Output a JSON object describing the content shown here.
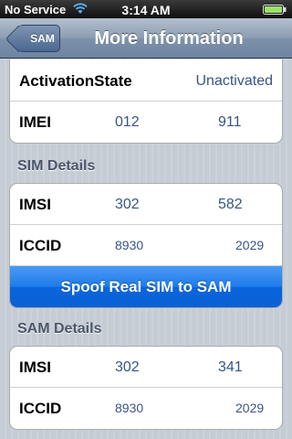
{
  "status_bar": {
    "carrier": "No Service",
    "time": "3:14 AM"
  },
  "nav": {
    "back_label": "SAM",
    "title": "More Information"
  },
  "info": {
    "activation_label": "ActivationState",
    "activation_value": "Unactivated",
    "imei_label": "IMEI",
    "imei_part1": "012",
    "imei_part2": "911"
  },
  "sim_details": {
    "header": "SIM Details",
    "imsi_label": "IMSI",
    "imsi_part1": "302",
    "imsi_part2": "582",
    "iccid_label": "ICCID",
    "iccid_part1": "8930",
    "iccid_part2": "2029",
    "spoof_button": "Spoof Real SIM to SAM"
  },
  "sam_details": {
    "header": "SAM Details",
    "imsi_label": "IMSI",
    "imsi_part1": "302",
    "imsi_part2": "341",
    "iccid_label": "ICCID",
    "iccid_part1": "8930",
    "iccid_part2": "2029"
  },
  "icons": {
    "wifi": "wifi-icon",
    "battery": "battery-icon"
  },
  "colors": {
    "value_text": "#385487",
    "button_blue": "#1f7bea"
  }
}
